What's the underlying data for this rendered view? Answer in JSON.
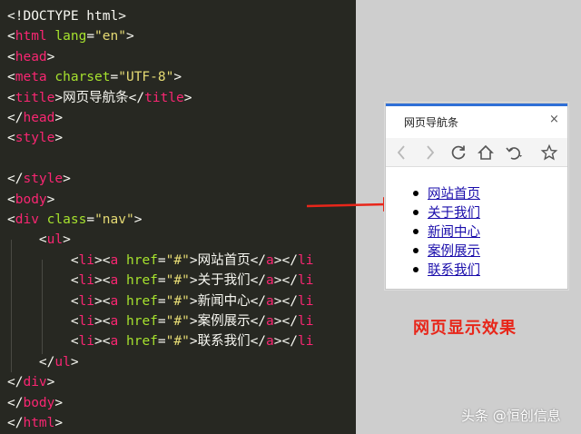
{
  "editor": {
    "lines": [
      [
        {
          "t": "<!DOCTYPE html>",
          "c": "tag-bracket"
        }
      ],
      [
        {
          "t": "<",
          "c": "txt"
        },
        {
          "t": "html",
          "c": "tag"
        },
        {
          "t": " lang",
          "c": "attr"
        },
        {
          "t": "=",
          "c": "txt"
        },
        {
          "t": "\"en\"",
          "c": "str"
        },
        {
          "t": ">",
          "c": "txt"
        }
      ],
      [
        {
          "t": "<",
          "c": "txt"
        },
        {
          "t": "head",
          "c": "tag"
        },
        {
          "t": ">",
          "c": "txt"
        }
      ],
      [
        {
          "t": "<",
          "c": "txt"
        },
        {
          "t": "meta",
          "c": "tag"
        },
        {
          "t": " charset",
          "c": "attr"
        },
        {
          "t": "=",
          "c": "txt"
        },
        {
          "t": "\"UTF-8\"",
          "c": "str"
        },
        {
          "t": ">",
          "c": "txt"
        }
      ],
      [
        {
          "t": "<",
          "c": "txt"
        },
        {
          "t": "title",
          "c": "tag"
        },
        {
          "t": ">",
          "c": "txt"
        },
        {
          "t": "网页导航条",
          "c": "txt"
        },
        {
          "t": "</",
          "c": "txt"
        },
        {
          "t": "title",
          "c": "tag"
        },
        {
          "t": ">",
          "c": "txt"
        }
      ],
      [
        {
          "t": "</",
          "c": "txt"
        },
        {
          "t": "head",
          "c": "tag"
        },
        {
          "t": ">",
          "c": "txt"
        }
      ],
      [
        {
          "t": "<",
          "c": "txt"
        },
        {
          "t": "style",
          "c": "tag"
        },
        {
          "t": ">",
          "c": "txt"
        }
      ],
      [],
      [
        {
          "t": "</",
          "c": "txt"
        },
        {
          "t": "style",
          "c": "tag"
        },
        {
          "t": ">",
          "c": "txt"
        }
      ],
      [
        {
          "t": "<",
          "c": "txt"
        },
        {
          "t": "body",
          "c": "tag"
        },
        {
          "t": ">",
          "c": "txt"
        }
      ],
      [
        {
          "t": "<",
          "c": "txt"
        },
        {
          "t": "div",
          "c": "tag"
        },
        {
          "t": " class",
          "c": "attr"
        },
        {
          "t": "=",
          "c": "txt"
        },
        {
          "t": "\"nav\"",
          "c": "str"
        },
        {
          "t": ">",
          "c": "txt"
        }
      ],
      [
        {
          "t": "    <",
          "c": "txt"
        },
        {
          "t": "ul",
          "c": "tag"
        },
        {
          "t": ">",
          "c": "txt"
        }
      ],
      [
        {
          "t": "        <",
          "c": "txt"
        },
        {
          "t": "li",
          "c": "tag"
        },
        {
          "t": "><",
          "c": "txt"
        },
        {
          "t": "a",
          "c": "tag"
        },
        {
          "t": " href",
          "c": "attr"
        },
        {
          "t": "=",
          "c": "txt"
        },
        {
          "t": "\"#\"",
          "c": "str"
        },
        {
          "t": ">网站首页</",
          "c": "txt"
        },
        {
          "t": "a",
          "c": "tag"
        },
        {
          "t": "></",
          "c": "txt"
        },
        {
          "t": "li",
          "c": "tag"
        }
      ],
      [
        {
          "t": "        <",
          "c": "txt"
        },
        {
          "t": "li",
          "c": "tag"
        },
        {
          "t": "><",
          "c": "txt"
        },
        {
          "t": "a",
          "c": "tag"
        },
        {
          "t": " href",
          "c": "attr"
        },
        {
          "t": "=",
          "c": "txt"
        },
        {
          "t": "\"#\"",
          "c": "str"
        },
        {
          "t": ">关于我们</",
          "c": "txt"
        },
        {
          "t": "a",
          "c": "tag"
        },
        {
          "t": "></",
          "c": "txt"
        },
        {
          "t": "li",
          "c": "tag"
        }
      ],
      [
        {
          "t": "        <",
          "c": "txt"
        },
        {
          "t": "li",
          "c": "tag"
        },
        {
          "t": "><",
          "c": "txt"
        },
        {
          "t": "a",
          "c": "tag"
        },
        {
          "t": " href",
          "c": "attr"
        },
        {
          "t": "=",
          "c": "txt"
        },
        {
          "t": "\"#\"",
          "c": "str"
        },
        {
          "t": ">新闻中心</",
          "c": "txt"
        },
        {
          "t": "a",
          "c": "tag"
        },
        {
          "t": "></",
          "c": "txt"
        },
        {
          "t": "li",
          "c": "tag"
        }
      ],
      [
        {
          "t": "        <",
          "c": "txt"
        },
        {
          "t": "li",
          "c": "tag"
        },
        {
          "t": "><",
          "c": "txt"
        },
        {
          "t": "a",
          "c": "tag"
        },
        {
          "t": " href",
          "c": "attr"
        },
        {
          "t": "=",
          "c": "txt"
        },
        {
          "t": "\"#\"",
          "c": "str"
        },
        {
          "t": ">案例展示</",
          "c": "txt"
        },
        {
          "t": "a",
          "c": "tag"
        },
        {
          "t": "></",
          "c": "txt"
        },
        {
          "t": "li",
          "c": "tag"
        }
      ],
      [
        {
          "t": "        <",
          "c": "txt"
        },
        {
          "t": "li",
          "c": "tag"
        },
        {
          "t": "><",
          "c": "txt"
        },
        {
          "t": "a",
          "c": "tag"
        },
        {
          "t": " href",
          "c": "attr"
        },
        {
          "t": "=",
          "c": "txt"
        },
        {
          "t": "\"#\"",
          "c": "str"
        },
        {
          "t": ">联系我们</",
          "c": "txt"
        },
        {
          "t": "a",
          "c": "tag"
        },
        {
          "t": "></",
          "c": "txt"
        },
        {
          "t": "li",
          "c": "tag"
        }
      ],
      [
        {
          "t": "    </",
          "c": "txt"
        },
        {
          "t": "ul",
          "c": "tag"
        },
        {
          "t": ">",
          "c": "txt"
        }
      ],
      [
        {
          "t": "</",
          "c": "txt"
        },
        {
          "t": "div",
          "c": "tag"
        },
        {
          "t": ">",
          "c": "txt"
        }
      ],
      [
        {
          "t": "</",
          "c": "txt"
        },
        {
          "t": "body",
          "c": "tag"
        },
        {
          "t": ">",
          "c": "txt"
        }
      ],
      [
        {
          "t": "</",
          "c": "txt"
        },
        {
          "t": "html",
          "c": "tag"
        },
        {
          "t": ">",
          "c": "txt"
        }
      ]
    ]
  },
  "browser": {
    "tab_title": "网页导航条",
    "close_glyph": "×",
    "toolbar_icons": [
      "back-icon",
      "forward-icon",
      "reload-icon",
      "home-icon",
      "undo-icon",
      "favorite-icon"
    ],
    "nav_links": [
      "网站首页",
      "关于我们",
      "新闻中心",
      "案例展示",
      "联系我们"
    ]
  },
  "caption": "网页显示效果",
  "watermark": "头条 @恒创信息",
  "colors": {
    "editor_bg": "#272822",
    "tag": "#f92672",
    "attr": "#a6e22e",
    "string": "#e6db74",
    "text": "#f8f8f2",
    "tab_accent": "#2f6fd6",
    "link": "#1a0dab",
    "caption": "#e8261a",
    "arrow": "#e8261a"
  }
}
